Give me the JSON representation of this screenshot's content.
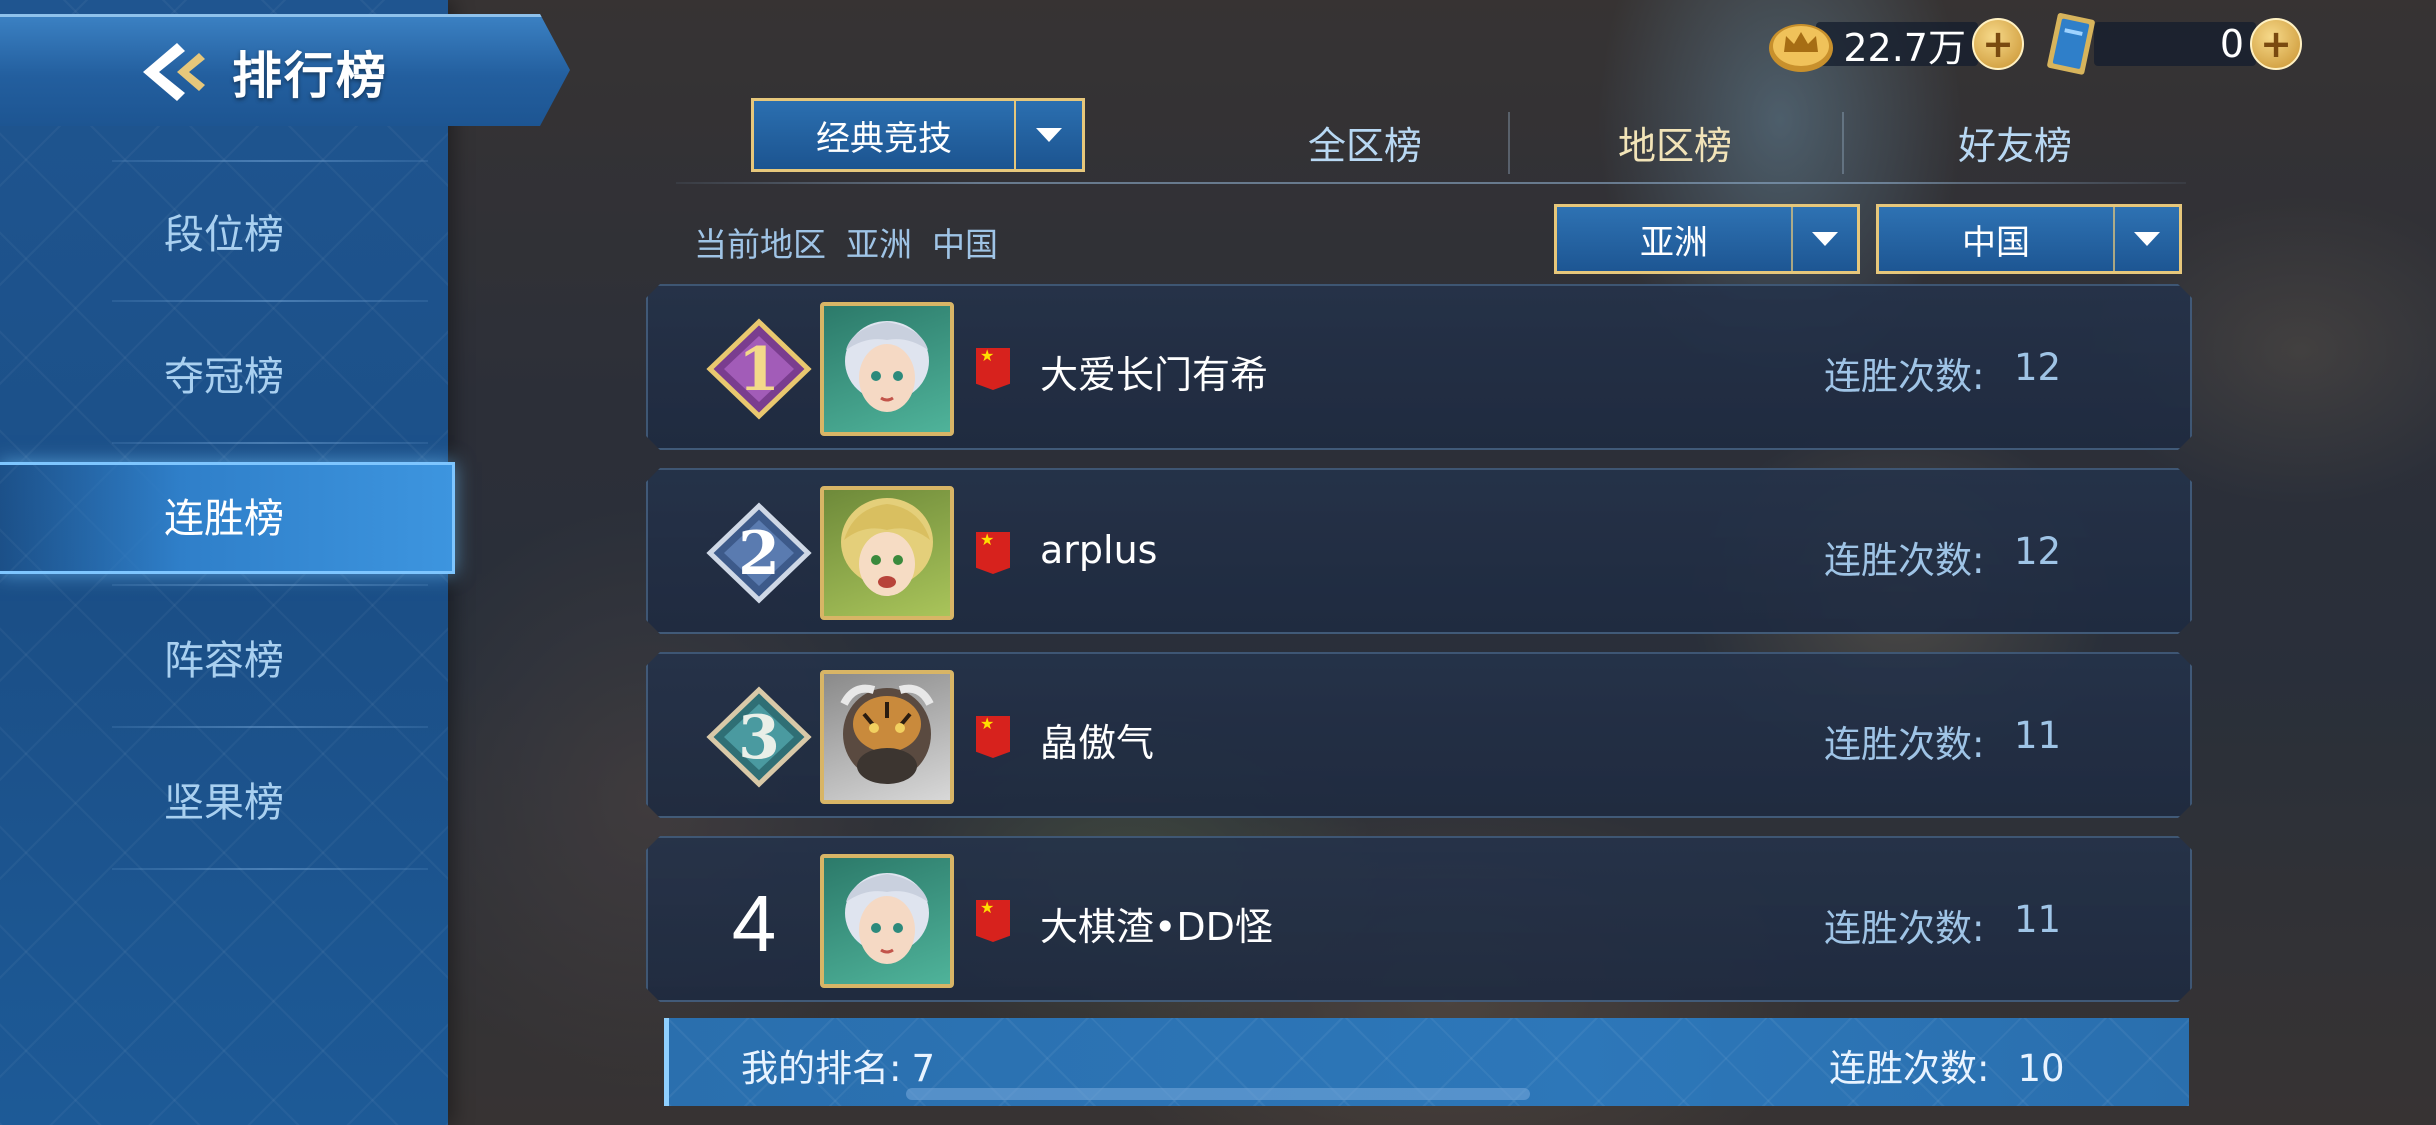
{
  "header": {
    "title": "排行榜"
  },
  "currency": {
    "gold": {
      "value": "22.7万"
    },
    "tickets": {
      "value": "0"
    }
  },
  "sidebar": {
    "items": [
      {
        "label": "段位榜",
        "active": false
      },
      {
        "label": "夺冠榜",
        "active": false
      },
      {
        "label": "连胜榜",
        "active": true
      },
      {
        "label": "阵容榜",
        "active": false
      },
      {
        "label": "坚果榜",
        "active": false
      }
    ]
  },
  "filters": {
    "mode": "经典竞技",
    "tabs": [
      {
        "label": "全区榜",
        "active": false
      },
      {
        "label": "地区榜",
        "active": true
      },
      {
        "label": "好友榜",
        "active": false
      }
    ],
    "current_region_label": "当前地区",
    "current_region": "亚洲",
    "current_country": "中国",
    "region_select": "亚洲",
    "country_select": "中国"
  },
  "rankings": [
    {
      "rank": "1",
      "name": "大爱长门有希",
      "streak_label": "连胜次数:",
      "streak": "12"
    },
    {
      "rank": "2",
      "name": "arplus",
      "streak_label": "连胜次数:",
      "streak": "12"
    },
    {
      "rank": "3",
      "name": "皛傲气",
      "streak_label": "连胜次数:",
      "streak": "11"
    },
    {
      "rank": "4",
      "name": "大棋渣•DD怪",
      "streak_label": "连胜次数:",
      "streak": "11"
    }
  ],
  "my_rank": {
    "label": "我的排名:",
    "rank": "7",
    "streak_label": "连胜次数:",
    "streak": "10"
  },
  "colors": {
    "gold_border": "#e6c77b",
    "sidebar_blue": "#1f5590",
    "text_light_blue": "#9fc4e6"
  }
}
